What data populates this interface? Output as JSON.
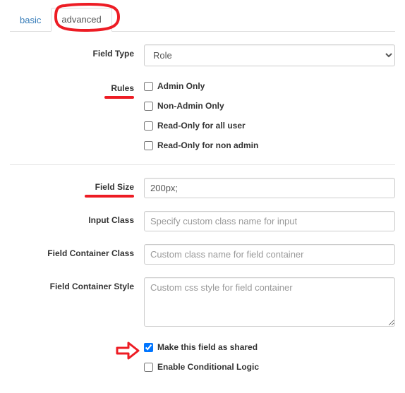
{
  "tabs": {
    "basic": "basic",
    "advanced": "advanced"
  },
  "labels": {
    "field_type": "Field Type",
    "rules": "Rules",
    "field_size": "Field Size",
    "input_class": "Input Class",
    "container_class": "Field Container Class",
    "container_style": "Field Container Style"
  },
  "field_type": {
    "selected": "Role"
  },
  "rules": {
    "admin_only": {
      "label": "Admin Only",
      "checked": false
    },
    "non_admin_only": {
      "label": "Non-Admin Only",
      "checked": false
    },
    "readonly_all": {
      "label": "Read-Only for all user",
      "checked": false
    },
    "readonly_nonadm": {
      "label": "Read-Only for non admin",
      "checked": false
    }
  },
  "field_size": {
    "value": "200px;"
  },
  "input_class": {
    "value": "",
    "placeholder": "Specify custom class name for input"
  },
  "container_class": {
    "value": "",
    "placeholder": "Custom class name for field container"
  },
  "container_style": {
    "value": "",
    "placeholder": "Custom css style for field container"
  },
  "shared": {
    "label": "Make this field as shared",
    "checked": true
  },
  "condlogic": {
    "label": "Enable Conditional Logic",
    "checked": false
  },
  "annotations": {
    "circle_on": "advanced-tab",
    "underline": [
      "rules-label",
      "field-size-label"
    ],
    "arrow_points_to": "make-shared-checkbox",
    "color": "#ed1c24"
  }
}
